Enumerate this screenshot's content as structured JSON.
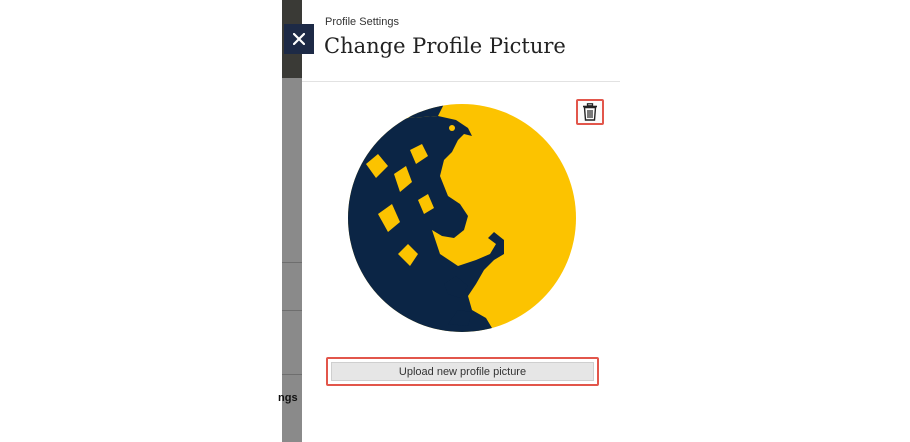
{
  "background_page": {
    "partial_label": "ngs"
  },
  "panel": {
    "breadcrumb": "Profile Settings",
    "title": "Change Profile Picture",
    "close_icon": "close-icon",
    "delete_icon": "trash-icon",
    "upload_label": "Upload new profile picture"
  },
  "colors": {
    "close_bg": "#1d2a46",
    "highlight_border": "#e2564b",
    "avatar_yellow": "#fcc300",
    "avatar_navy": "#0b2545"
  }
}
